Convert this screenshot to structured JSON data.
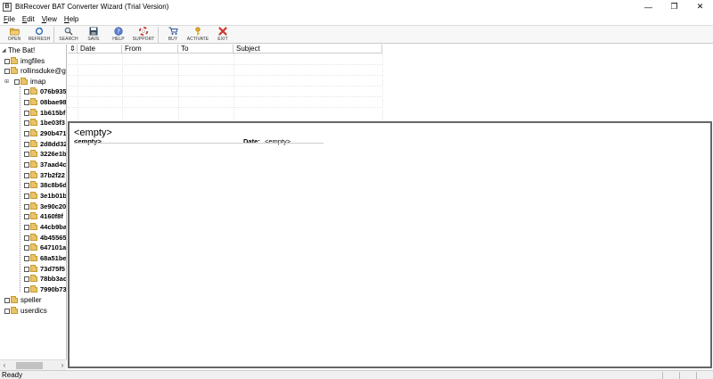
{
  "window": {
    "title": "BitRecover BAT Converter Wizard (Trial Version)",
    "app_icon_letter": "B",
    "controls": {
      "minimize": "—",
      "restore": "❐",
      "close": "✕"
    }
  },
  "menu": [
    "File",
    "Edit",
    "View",
    "Help"
  ],
  "toolbar": {
    "open": "OPEN",
    "refresh": "REFRESH",
    "search": "SEARCH",
    "save": "SAVE",
    "help": "HELP",
    "support": "SUPPORT",
    "buy": "BUY",
    "activate": "ACTIVATE",
    "exit": "EXIT"
  },
  "tree": {
    "root": "The Bat!",
    "top_items": [
      "imgfiles",
      "rollinsduke@gn",
      "imap"
    ],
    "imap_children": [
      "076b935",
      "08bae98",
      "1b615bf",
      "1be03f3",
      "290b471",
      "2d8dd32",
      "3226e1b",
      "37aad4c",
      "37b2f22",
      "38c8b6d",
      "3e1b01b",
      "3e90c20",
      "4160f8f",
      "44cb9ba",
      "4b45565",
      "647101a",
      "68a51be",
      "73d75f5",
      "78bb3ac",
      "7990b73"
    ],
    "bottom_items": [
      "speller",
      "userdics"
    ]
  },
  "list": {
    "columns": {
      "attach": "⇕",
      "date": "Date",
      "from": "From",
      "to": "To",
      "subject": "Subject"
    }
  },
  "preview": {
    "subject": "<empty>",
    "from": "<empty>",
    "date_label": "Date:",
    "date_value": "<empty>"
  },
  "status": {
    "text": "Ready"
  }
}
